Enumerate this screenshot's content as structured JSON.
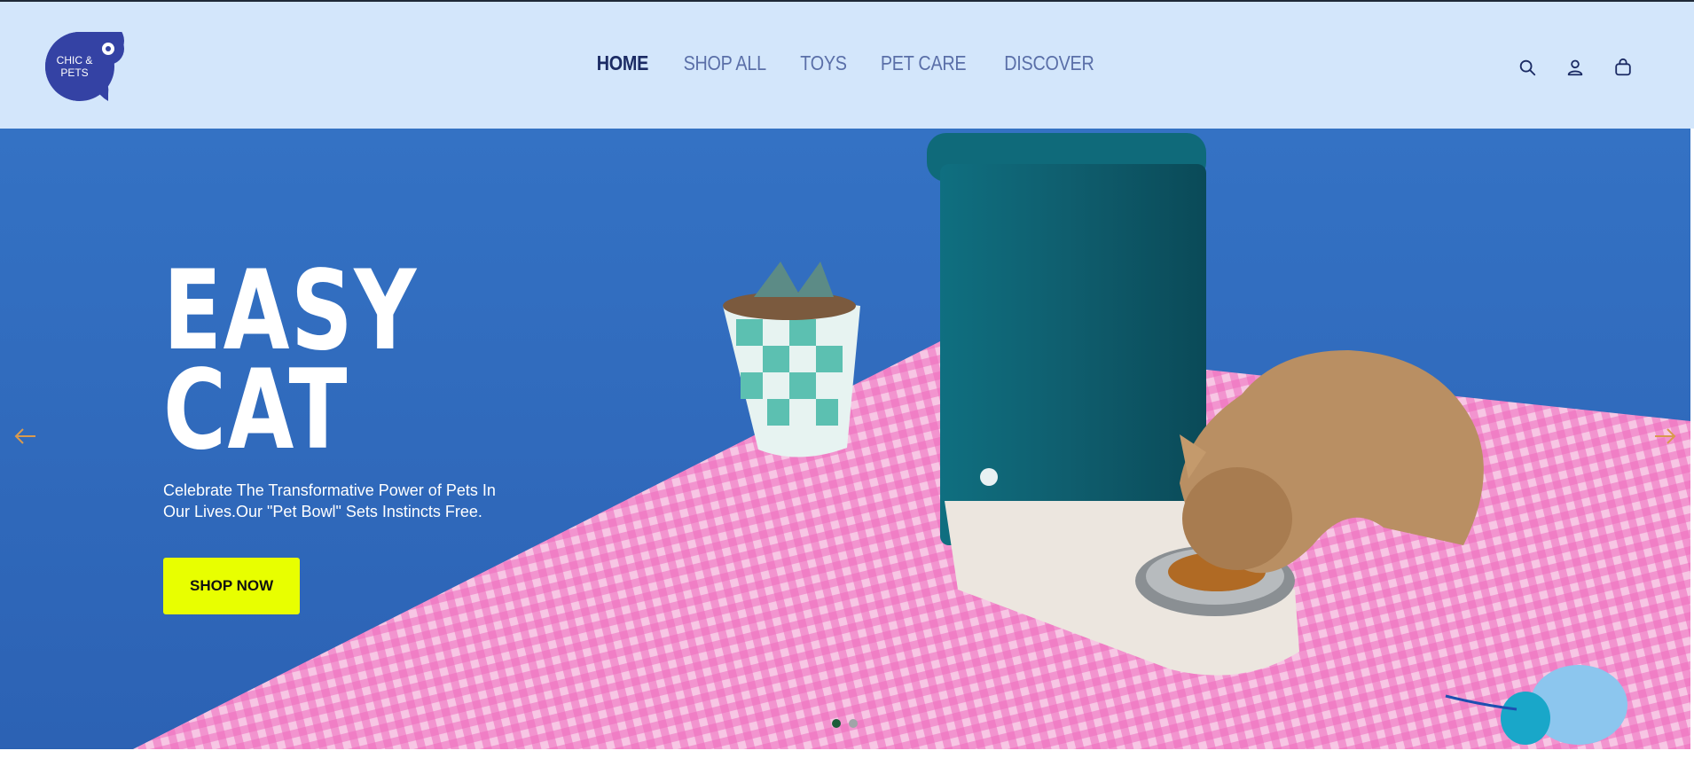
{
  "brand": {
    "logo_line1": "CHIC &",
    "logo_line2": "PETS",
    "color": "#3442a4"
  },
  "nav": {
    "items": [
      {
        "label": "HOME",
        "active": true
      },
      {
        "label": "SHOP ALL",
        "active": false
      },
      {
        "label": "TOYS",
        "active": false
      },
      {
        "label": "PET CARE",
        "active": false
      },
      {
        "label": "DISCOVER",
        "active": false
      }
    ]
  },
  "header_icons": [
    "search-icon",
    "account-icon",
    "cart-icon"
  ],
  "hero": {
    "title_line1": "EASY",
    "title_line2": "CAT",
    "description": "Celebrate The Transformative Power of Pets In Our Lives.Our \"Pet Bowl\" Sets Instincts Free.",
    "cta_label": "SHOP NOW",
    "cta_color": "#e8ff00",
    "slides_total": 2,
    "active_slide": 1
  },
  "colors": {
    "header_bg": "#d3e6fb",
    "hero_bg": "#2f6cc2",
    "nav_active": "#1b2b64",
    "nav_inactive": "#5a6fa8",
    "arrow": "#d99a4e"
  }
}
